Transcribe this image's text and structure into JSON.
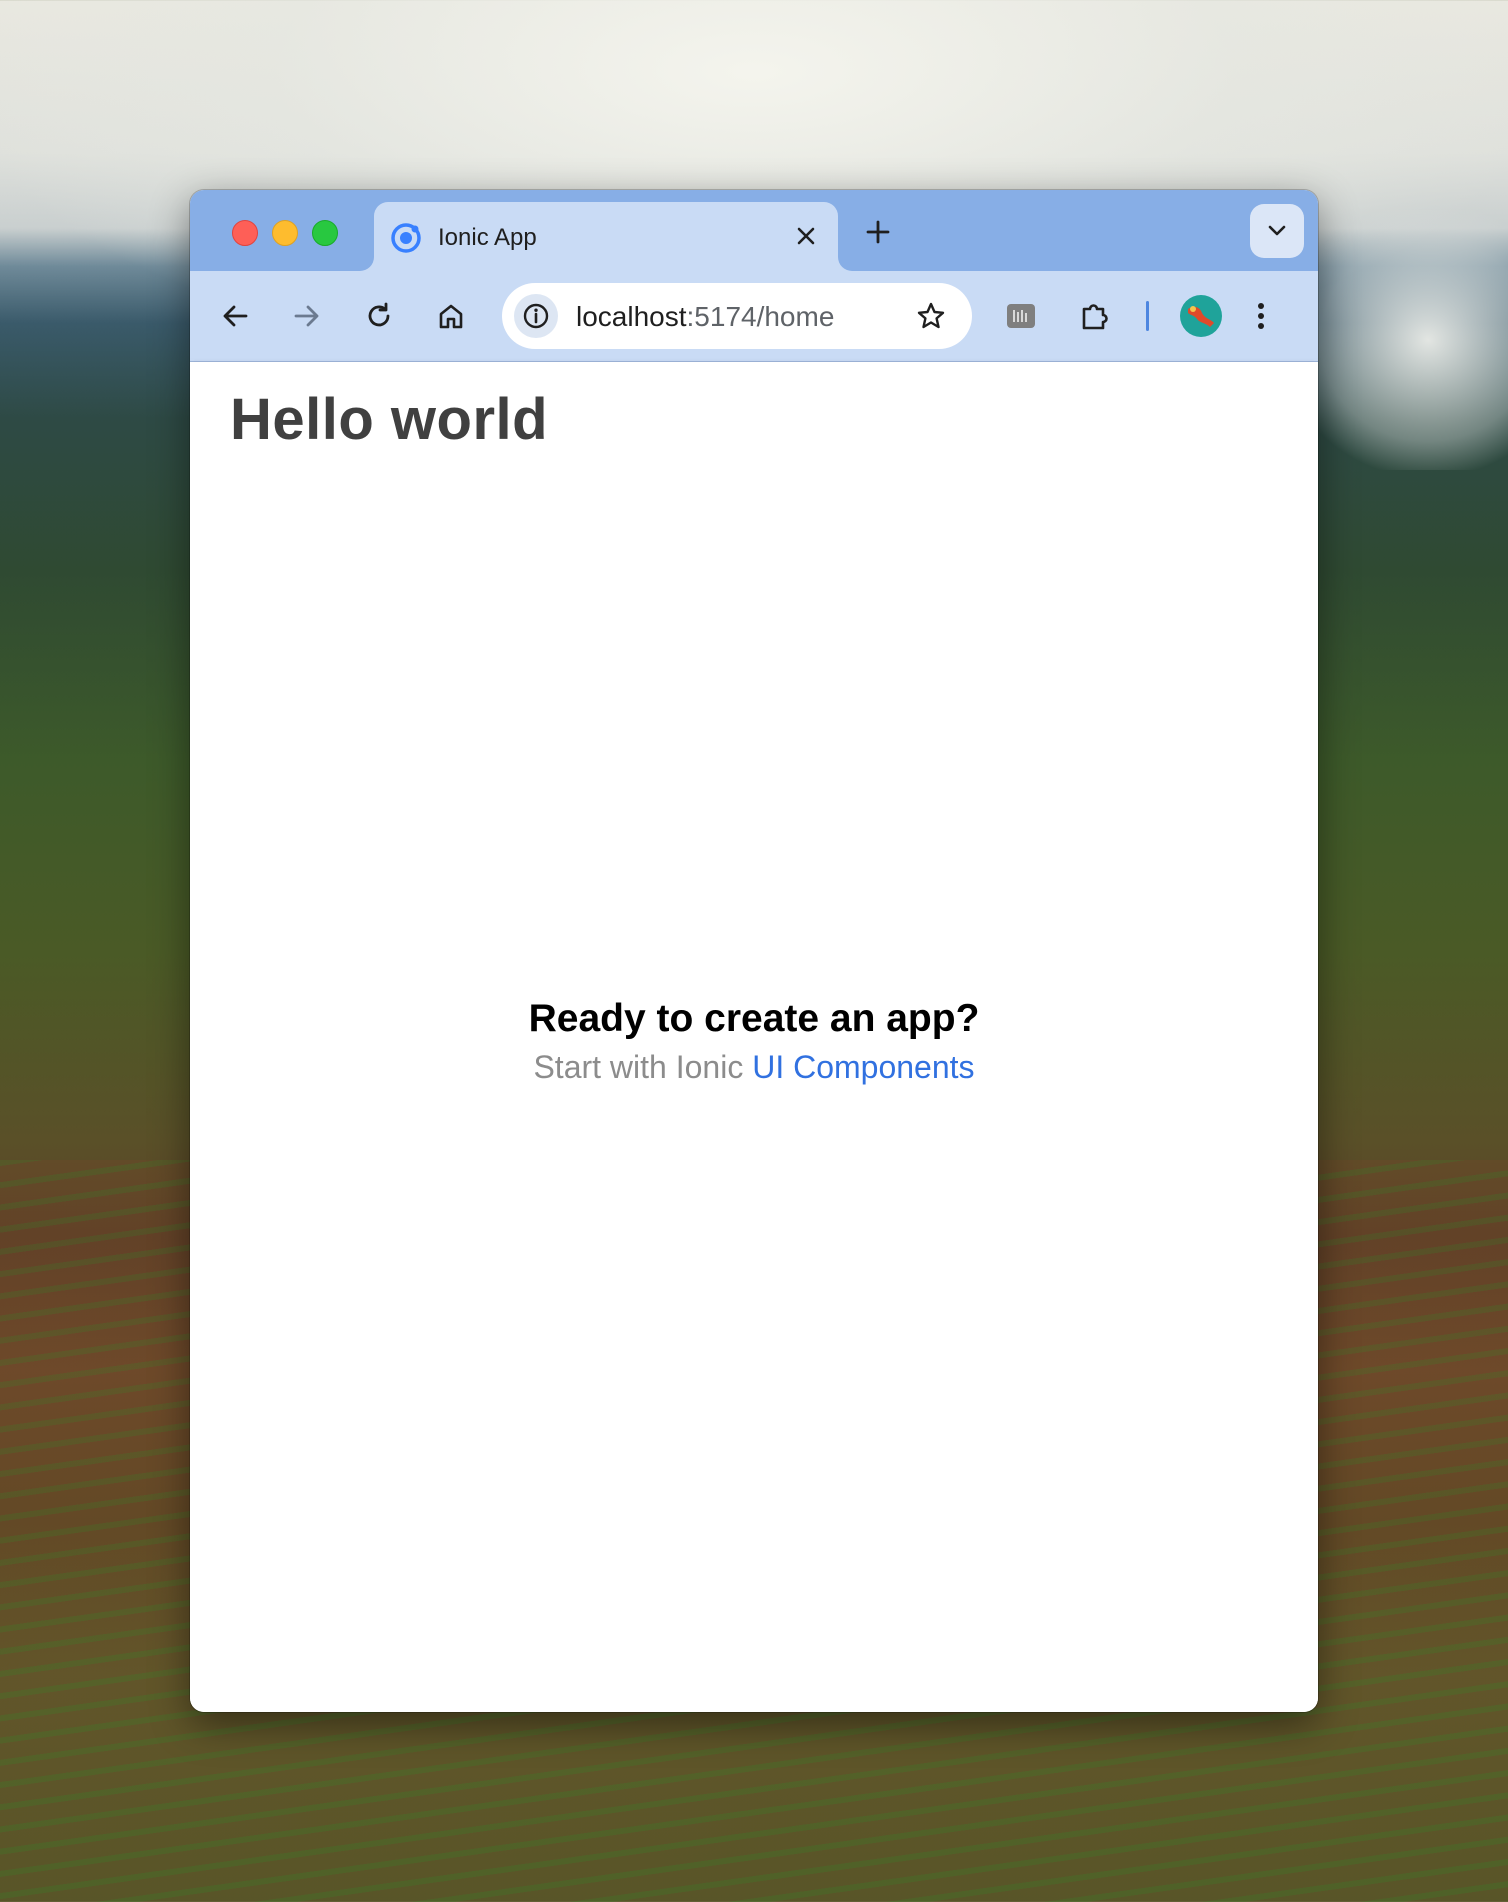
{
  "browser": {
    "tab": {
      "title": "Ionic App",
      "favicon": "ionic-logo-icon"
    },
    "url": {
      "host": "localhost",
      "rest": ":5174/home"
    }
  },
  "page": {
    "header_title": "Hello world",
    "headline": "Ready to create an app?",
    "sub_prefix": "Start with Ionic",
    "sub_link": "UI Components"
  },
  "colors": {
    "titlebar": "#87aee6",
    "toolbar": "#c9dbf5",
    "link": "#3171e0"
  }
}
